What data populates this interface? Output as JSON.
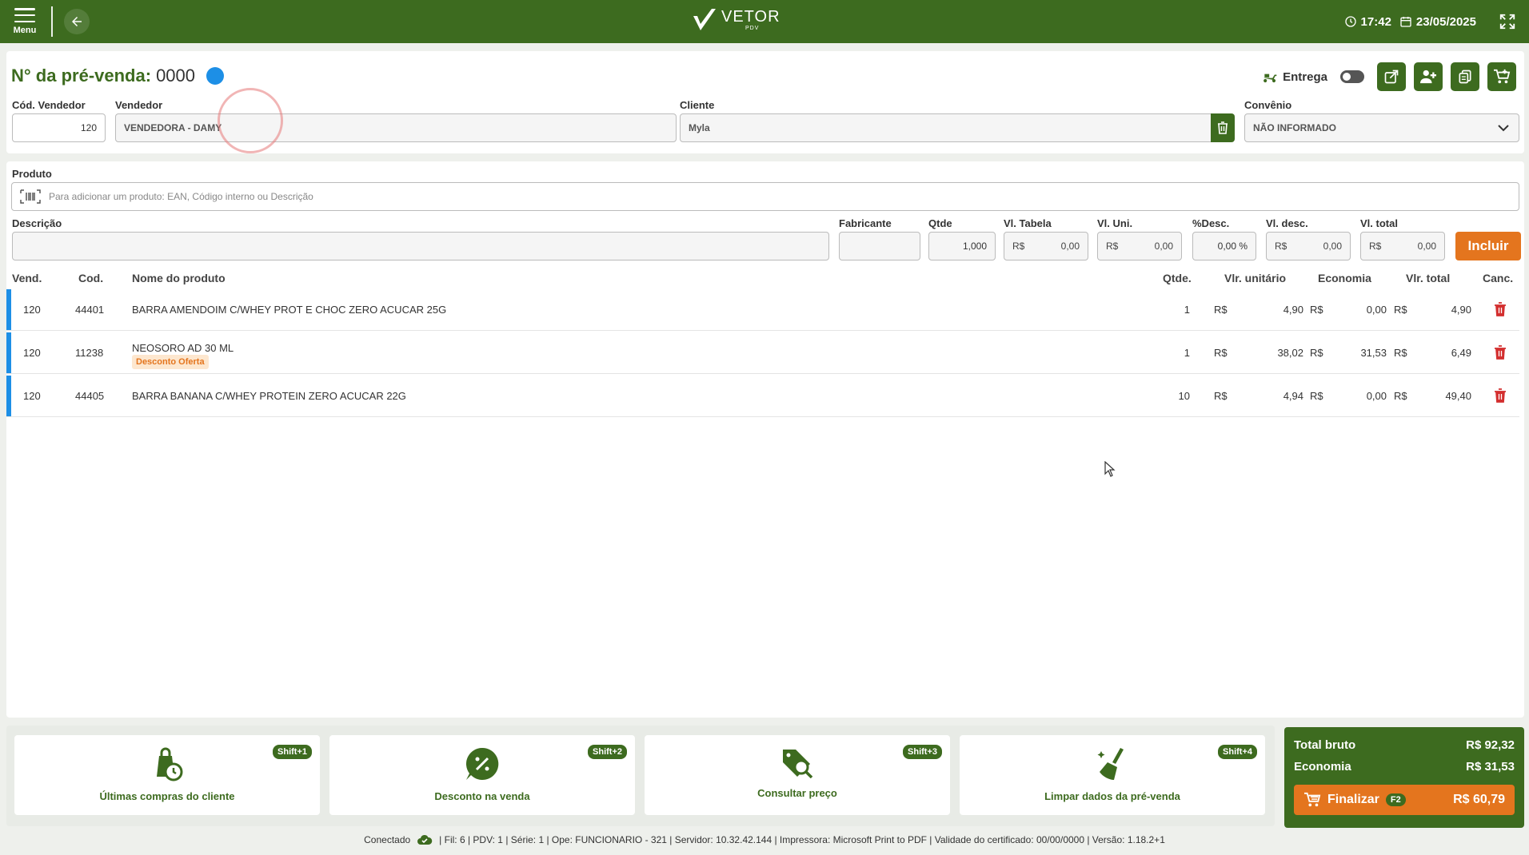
{
  "topbar": {
    "menu_label": "Menu",
    "logo_name": "VETOR",
    "logo_sub": "PDV",
    "time": "17:42",
    "date": "23/05/2025"
  },
  "header": {
    "title": "N° da pré-venda:",
    "number": "0000",
    "entrega_label": "Entrega",
    "cod_vendedor_label": "Cód. Vendedor",
    "cod_vendedor_value": "120",
    "vendedor_label": "Vendedor",
    "vendedor_value": "VENDEDORA - DAMY",
    "cliente_label": "Cliente",
    "cliente_value": "Myla",
    "convenio_label": "Convênio",
    "convenio_value": "NÃO INFORMADO"
  },
  "product_entry": {
    "produto_label": "Produto",
    "produto_placeholder": "Para adicionar um produto: EAN, Código interno ou Descrição",
    "descricao_label": "Descrição",
    "fabricante_label": "Fabricante",
    "qtde_label": "Qtde",
    "qtde_value": "1,000",
    "vl_tabela_label": "Vl. Tabela",
    "vl_uni_label": "Vl. Uni.",
    "pct_desc_label": "%Desc.",
    "pct_desc_value": "0,00 %",
    "vl_desc_label": "Vl. desc.",
    "vl_total_label": "Vl. total",
    "currency": "R$",
    "zero_value": "0,00",
    "incluir_label": "Incluir"
  },
  "table": {
    "headers": {
      "vend": "Vend.",
      "cod": "Cod.",
      "nome": "Nome do produto",
      "qtde": "Qtde.",
      "vlr_unitario": "Vlr. unitário",
      "economia": "Economia",
      "vlr_total": "Vlr. total",
      "canc": "Canc."
    },
    "currency": "R$",
    "rows": [
      {
        "vend": "120",
        "cod": "44401",
        "nome": "BARRA AMENDOIM C/WHEY PROT E CHOC ZERO ACUCAR 25G",
        "qtde": "1",
        "unit": "4,90",
        "economia": "0,00",
        "total": "4,90",
        "badge": ""
      },
      {
        "vend": "120",
        "cod": "11238",
        "nome": "NEOSORO AD 30 ML",
        "qtde": "1",
        "unit": "38,02",
        "economia": "31,53",
        "total": "6,49",
        "badge": "Desconto Oferta"
      },
      {
        "vend": "120",
        "cod": "44405",
        "nome": "BARRA BANANA C/WHEY PROTEIN ZERO ACUCAR 22G",
        "qtde": "10",
        "unit": "4,94",
        "economia": "0,00",
        "total": "49,40",
        "badge": ""
      }
    ]
  },
  "shortcuts": [
    {
      "label": "Últimas compras do cliente",
      "key": "Shift+1",
      "icon": "bag-clock-icon"
    },
    {
      "label": "Desconto na venda",
      "key": "Shift+2",
      "icon": "discount-icon"
    },
    {
      "label": "Consultar preço",
      "key": "Shift+3",
      "icon": "price-tag-search-icon"
    },
    {
      "label": "Limpar dados da pré-venda",
      "key": "Shift+4",
      "icon": "broom-icon"
    }
  ],
  "totals": {
    "total_bruto_label": "Total bruto",
    "total_bruto_value": "R$ 92,32",
    "economia_label": "Economia",
    "economia_value": "R$ 31,53",
    "finalizar_label": "Finalizar",
    "finalizar_key": "F2",
    "finalizar_value": "R$ 60,79"
  },
  "status": {
    "conectado": "Conectado",
    "info": "| Fil: 6 | PDV: 1 | Série: 1 | Ope: FUNCIONARIO - 321 | Servidor: 10.32.42.144 | Impressora: Microsoft Print to PDF | Validade do certificado: 00/00/0000 | Versão: 1.18.2+1"
  },
  "colors": {
    "primary_green": "#3d6b1f",
    "accent_orange": "#e4751e",
    "row_marker_blue": "#1d8fe6",
    "delete_red": "#d32f2f"
  }
}
